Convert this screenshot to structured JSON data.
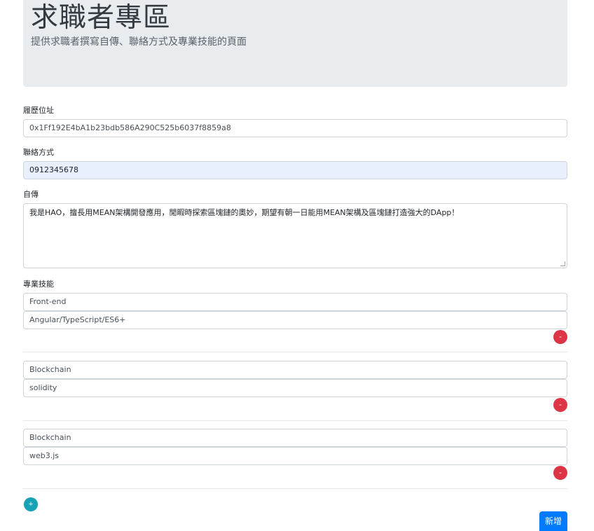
{
  "header": {
    "title": "求職者專區",
    "subtitle": "提供求職者撰寫自傳、聯絡方式及專業技能的頁面"
  },
  "form": {
    "resume_address_label": "履歷位址",
    "resume_address_value": "0x1Ff192E4bA1b23bdb586A290C525b6037f8859a8",
    "contact_label": "聯絡方式",
    "contact_value": "0912345678",
    "bio_label": "自傳",
    "bio_value": "我是HAO，擅長用MEAN架構開發應用，閒暇時探索區塊鏈的奧妙，期望有朝一日能用MEAN架構及區塊鏈打造強大的DApp！",
    "skills_label": "專業技能",
    "skills": [
      {
        "category": "Front-end",
        "detail": "Angular/TypeScript/ES6+",
        "remove_label": "-"
      },
      {
        "category": "Blockchain",
        "detail": "solidity",
        "remove_label": "-"
      },
      {
        "category": "Blockchain",
        "detail": "web3.js",
        "remove_label": "-"
      }
    ],
    "add_skill_label": "+",
    "submit_label": "新增"
  },
  "colors": {
    "jumbotron_bg": "#e9ecef",
    "danger": "#dc3545",
    "info": "#17a2b8",
    "primary": "#007bff",
    "autofill_bg": "#e8f0fe"
  }
}
